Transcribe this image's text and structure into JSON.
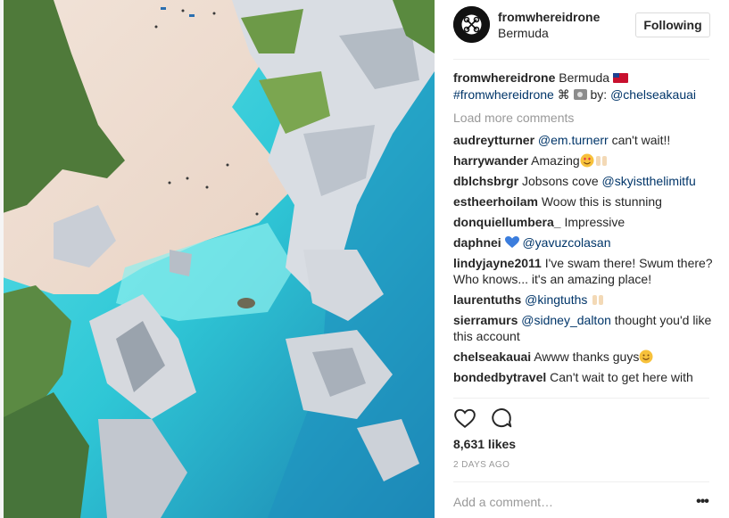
{
  "post": {
    "username": "fromwhereidrone",
    "location": "Bermuda",
    "follow_label": "Following",
    "caption": {
      "username": "fromwhereidrone",
      "text_before_flag": "Bermuda",
      "hashtag": "#fromwhereidrone",
      "symbol": "⌘",
      "by_text": "by:",
      "credit": "@chelseakauai"
    },
    "load_more_label": "Load more comments",
    "comments": [
      {
        "user": "audreytturner",
        "mention": "@em.turnerr",
        "text": "can't wait!!"
      },
      {
        "user": "harrywander",
        "text": "Amazing"
      },
      {
        "user": "dblchsbrgr",
        "text": "Jobsons cove",
        "mention": "@skyistthelimitfu"
      },
      {
        "user": "estheerhoilam",
        "text": "Woow this is stunning"
      },
      {
        "user": "donquiellumbera_",
        "text": "Impressive"
      },
      {
        "user": "daphnei",
        "mention": "@yavuzcolasan"
      },
      {
        "user": "lindyjayne2011",
        "text": "I've swam there! Swum there? Who knows... it's an amazing place!"
      },
      {
        "user": "laurentuths",
        "mention": "@kingtuths"
      },
      {
        "user": "sierramurs",
        "mention": "@sidney_dalton",
        "text": "thought you'd like this account"
      },
      {
        "user": "chelseakauai",
        "text": "Awww thanks guys"
      },
      {
        "user": "bondedbytravel",
        "text": "Can't wait to get here with"
      }
    ],
    "likes": "8,631 likes",
    "timestamp": "2 DAYS AGO",
    "add_comment_placeholder": "Add a comment…",
    "more_label": "•••"
  },
  "icons": {
    "like": "heart-outline-icon",
    "comment": "comment-bubble-icon",
    "flag": "bermuda-flag-icon",
    "camera": "camera-icon",
    "heart_eyes": "heart-eyes-emoji",
    "raised_hands": "raised-hands-emoji",
    "blue_heart": "blue-heart-emoji",
    "smile": "smiling-face-emoji"
  },
  "colors": {
    "text": "#262626",
    "link": "#003569",
    "muted": "#999999",
    "border": "#dbdbdb"
  }
}
